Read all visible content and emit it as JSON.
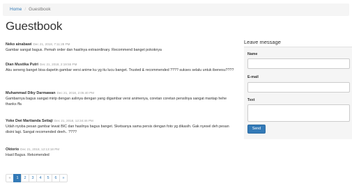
{
  "breadcrumb": {
    "home": "Home",
    "separator": "/",
    "current": "Guestbook"
  },
  "page_title": "Guestbook",
  "entries": [
    {
      "name": "Neko ainabawi",
      "date": "Dec 21, 2018, 7:11:28 PM",
      "message": "Gambar sangat bagus. Pemah order dan hasilnya extraordinary. Recommend banget pokoknya"
    },
    {
      "name": "Dian Mustika Putri",
      "date": "Dec 21, 2018, 2:19:55 PM",
      "message": "Aku seneng banget bisa dapetin gambar versi anime ku yg itu lucu banget. Trusted & recommended ???? sukses selalu untuk ibenesu????"
    },
    {
      "name": "Muhammad Diky Darmawan",
      "date": "Dec 21, 2018, 2:05:40 PM",
      "message": "Gambarnya bagus sangat mirip dengan aslinya dengan yang digambar versi animenya, coretan coretan pensilnya sangat mantap hehe thanks ffa"
    },
    {
      "name": "Yoke Dwi Martianda Setiaji",
      "date": "Dec 21, 2018, 12:34:46 PM",
      "message": "Udah nyoba pesan gambar lewat BIC dan hasilnya bagus banget. Sketsanya sama persis dengan foto yg dikasih. Gak nyesel deh pesan disini lagi. Sangat recomended deeh.. ????"
    },
    {
      "name": "Oktorio",
      "date": "Dec 21, 2018, 12:13:18 PM",
      "message": "Hasil Bagus. Rekomended"
    }
  ],
  "pagination": {
    "prev": "«",
    "pages": [
      "1",
      "2",
      "3",
      "4",
      "5",
      "6"
    ],
    "next": "»",
    "active_page": "1"
  },
  "form": {
    "title": "Leave message",
    "name_label": "Name",
    "email_label": "E-mail",
    "text_label": "Text",
    "send_label": "Send"
  },
  "colors": {
    "accent": "#337ab7",
    "panel_bg": "#f5f5f5",
    "breadcrumb_bg": "#f5f5f5"
  }
}
